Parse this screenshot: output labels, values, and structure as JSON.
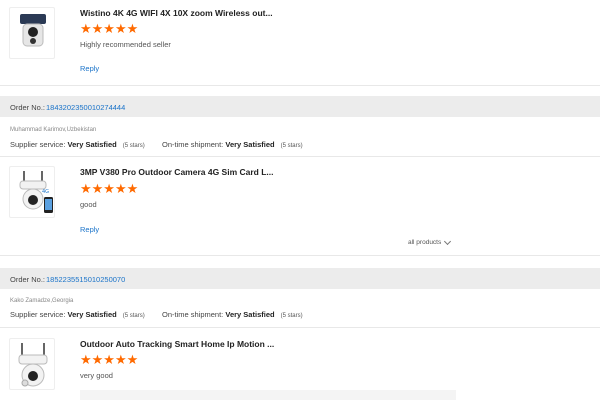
{
  "reviews": [
    {
      "title": "Wistino 4K 4G WIFI 4X 10X zoom Wireless out...",
      "stars": "★★★★★",
      "comment": "Highly recommended seller",
      "reply": "Reply"
    },
    {
      "title": "3MP V380 Pro Outdoor Camera 4G Sim Card L...",
      "stars": "★★★★★",
      "comment": "good",
      "reply": "Reply"
    },
    {
      "title": "Outdoor Auto Tracking Smart Home Ip Motion ...",
      "stars": "★★★★★",
      "comment": "very good"
    }
  ],
  "orders": [
    {
      "label": "Order No.:",
      "number": "1843202350010274444",
      "buyer": "Muhammad Karimov,Uzbekistan",
      "supplier_label": "Supplier service:",
      "supplier_value": "Very Satisfied",
      "supplier_stars": "(5 stars)",
      "shipment_label": "On-time shipment:",
      "shipment_value": "Very Satisfied",
      "shipment_stars": "(5 stars)"
    },
    {
      "label": "Order No.:",
      "number": "1852235515010250070",
      "buyer": "Kako Zamadze,Georgia",
      "supplier_label": "Supplier service:",
      "supplier_value": "Very Satisfied",
      "supplier_stars": "(5 stars)",
      "shipment_label": "On-time shipment:",
      "shipment_value": "Very Satisfied",
      "shipment_stars": "(5 stars)"
    }
  ],
  "all_products": "all products",
  "colors": {
    "accent": "#ff6a00",
    "link": "#1a73c9",
    "bar": "#ececec"
  }
}
